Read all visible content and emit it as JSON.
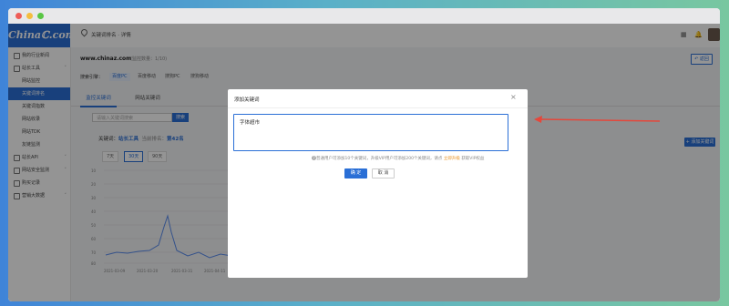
{
  "brand": {
    "logo": "Chinaℂ.com",
    "accent": "#2a6fd6"
  },
  "header": {
    "breadcrumb": "关键词排名 · 详情"
  },
  "sidebar": {
    "items": [
      {
        "label": "我的行业新闻"
      },
      {
        "label": "站长工具",
        "arrow": "˅"
      },
      {
        "label": "网站监控"
      },
      {
        "label": "关键词排名"
      },
      {
        "label": "关键词指数"
      },
      {
        "label": "网站收录"
      },
      {
        "label": "网站TDK"
      },
      {
        "label": "友链监测"
      },
      {
        "label": "站长API",
        "arrow": "˅"
      },
      {
        "label": "网站安全监测",
        "arrow": "˅"
      },
      {
        "label": "购买记录"
      },
      {
        "label": "营销大数据",
        "arrow": "˅"
      }
    ]
  },
  "main": {
    "site": "www.chinaz.com",
    "site_count": "(监控数量：1/10)",
    "return_label": "↶ 返回",
    "engines_label": "搜索引擎：",
    "engines": [
      "百度PC",
      "百度移动",
      "搜狗PC",
      "搜狗移动"
    ],
    "tabs": [
      "监控关键词",
      "网站关键词"
    ],
    "search_placeholder": "请输入关键词搜索",
    "search_btn": "搜索",
    "add_keyword_btn": "+ 添加关键词",
    "kw_label": "关键词：",
    "kw_value": "站长工具",
    "rank_label": "当前排名：",
    "rank_value": "第42名",
    "ranges": [
      "7天",
      "30天",
      "90天"
    ],
    "chart_ticks": [
      "10",
      "20",
      "30",
      "40",
      "50",
      "60",
      "70",
      "80"
    ],
    "chart_dates": [
      "2021-03-09",
      "2021-03-20",
      "2021-03-31",
      "2021-04-11"
    ]
  },
  "modal": {
    "title": "添加关键词",
    "close": "×",
    "textarea_value": "字体超市",
    "hint_pre": "普通用户可添加10个关键词，升级VIP用户可添加200个关键词，请点",
    "hint_link": "立即升级",
    "hint_post": "获取VIP权益",
    "ok": "确 定",
    "cancel": "取 消"
  }
}
